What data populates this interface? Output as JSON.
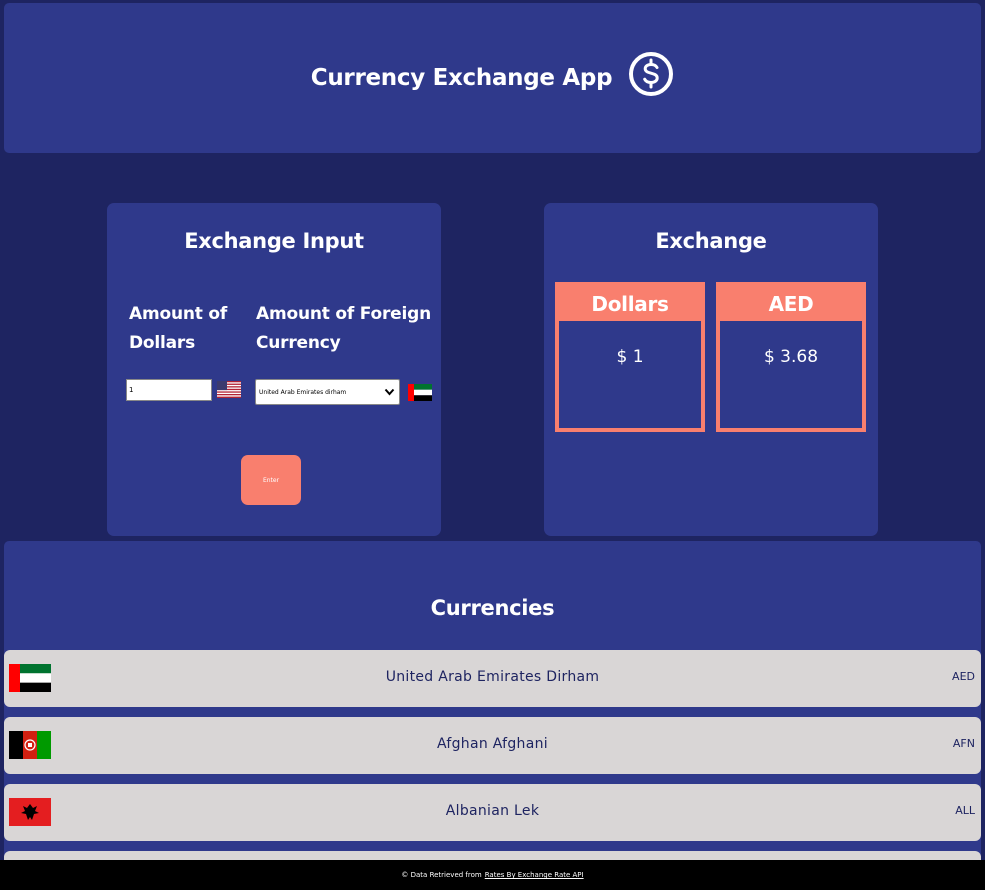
{
  "header": {
    "title": "Currency Exchange App",
    "icon": "dollar-circle-icon"
  },
  "input_panel": {
    "title": "Exchange Input",
    "dollars_label": "Amount of Dollars",
    "foreign_label": "Amount of Foreign Currency",
    "amount_value": "1",
    "selected_currency": "United Arab Emirates dirham",
    "enter_label": "Enter"
  },
  "exchange_panel": {
    "title": "Exchange",
    "left": {
      "heading": "Dollars",
      "value": "$ 1"
    },
    "right": {
      "heading": "AED",
      "value": "$ 3.68"
    }
  },
  "currencies": {
    "title": "Currencies",
    "items": [
      {
        "name": "United Arab Emirates Dirham",
        "code": "AED",
        "flag": "uae-flag-icon"
      },
      {
        "name": "Afghan Afghani",
        "code": "AFN",
        "flag": "afghanistan-flag-icon"
      },
      {
        "name": "Albanian Lek",
        "code": "ALL",
        "flag": "albania-flag-icon"
      }
    ]
  },
  "footer": {
    "prefix": "© Data Retrieved from",
    "link": "Rates By Exchange Rate API"
  },
  "colors": {
    "background": "#1e2461",
    "panel": "#2f398b",
    "accent": "#f97f6e",
    "row": "#d9d6d6"
  }
}
